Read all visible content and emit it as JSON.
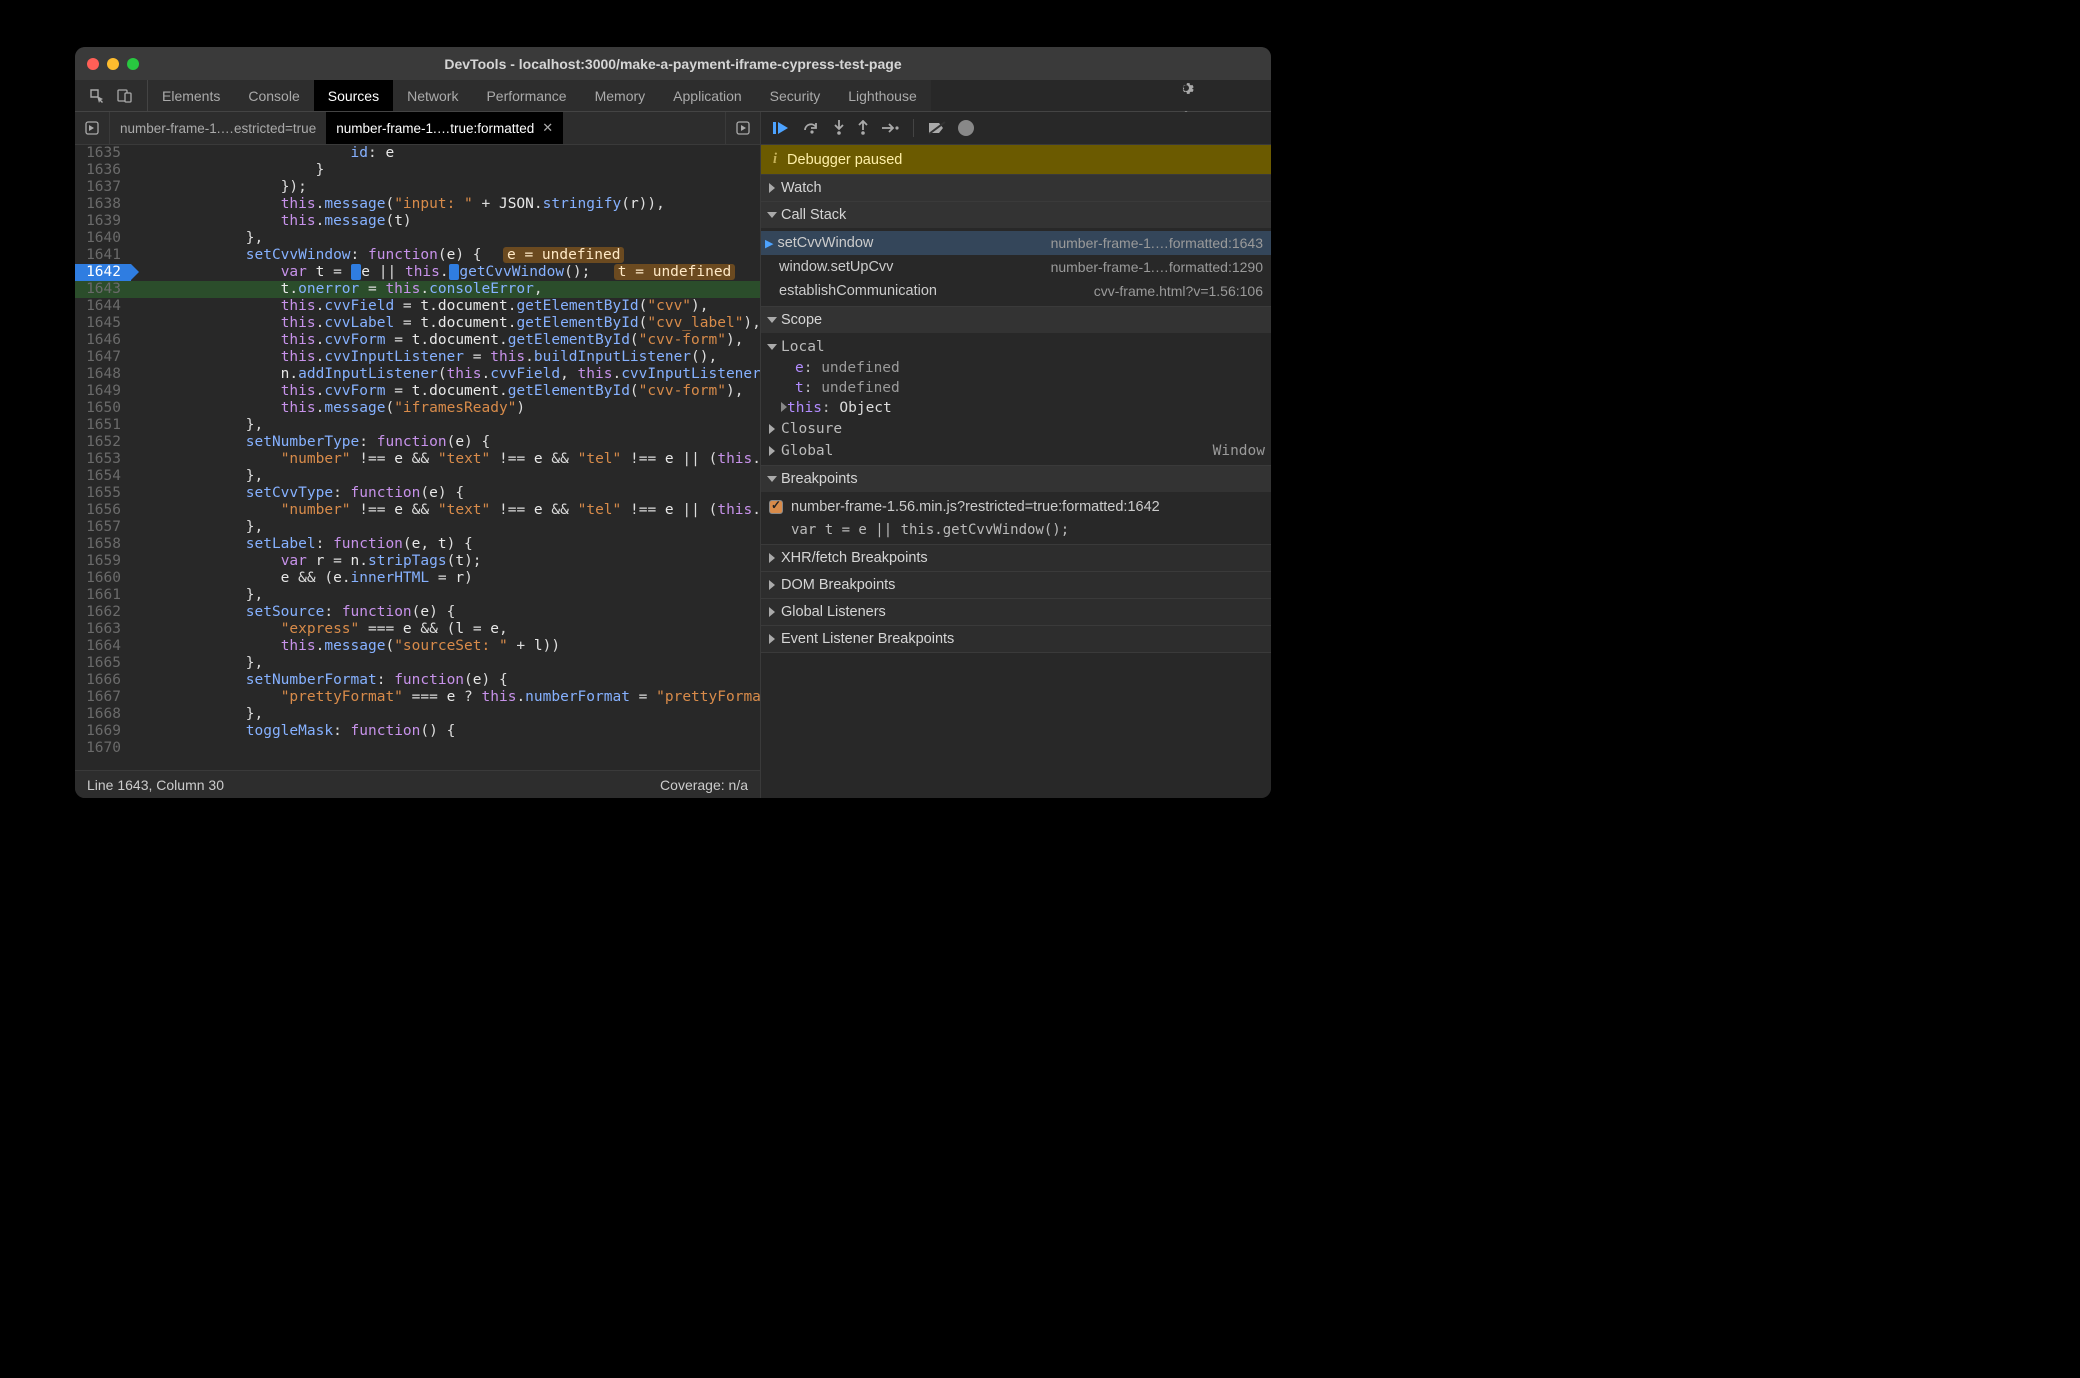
{
  "window": {
    "title": "DevTools - localhost:3000/make-a-payment-iframe-cypress-test-page"
  },
  "tabs": [
    "Elements",
    "Console",
    "Sources",
    "Network",
    "Performance",
    "Memory",
    "Application",
    "Security",
    "Lighthouse"
  ],
  "activeTab": "Sources",
  "fileTabs": {
    "first": "number-frame-1.…estricted=true",
    "second": "number-frame-1.…true:formatted"
  },
  "debugger": {
    "bannerLabel": "Debugger paused",
    "sections": {
      "watch": "Watch",
      "callstack": "Call Stack",
      "scope": "Scope",
      "breakpoints": "Breakpoints",
      "xhr": "XHR/fetch Breakpoints",
      "dom": "DOM Breakpoints",
      "global": "Global Listeners",
      "event": "Event Listener Breakpoints"
    },
    "callstack": [
      {
        "fn": "setCvvWindow",
        "loc": "number-frame-1.…formatted:1643",
        "active": true
      },
      {
        "fn": "window.setUpCvv",
        "loc": "number-frame-1.…formatted:1290"
      },
      {
        "fn": "establishCommunication",
        "loc": "cvv-frame.html?v=1.56:106"
      }
    ],
    "scope": {
      "localLabel": "Local",
      "e": {
        "name": "e",
        "value": "undefined"
      },
      "t": {
        "name": "t",
        "value": "undefined"
      },
      "thisLabel": "this",
      "thisVal": "Object",
      "closure": "Closure",
      "global": "Global",
      "globalVal": "Window"
    },
    "breakpoints": {
      "file": "number-frame-1.56.min.js?restricted=true:formatted:1642",
      "code": "var t = e || this.getCvvWindow();"
    }
  },
  "statusbar": {
    "left": "Line 1643, Column 30",
    "right": "Coverage: n/a"
  },
  "code": {
    "startLine": 1635,
    "hint_e": "e = undefined",
    "hint_t": "t = undefined",
    "lines": [
      {
        "n": 1635,
        "html": "                        <span class='prop'>id</span><span class='punct'>:</span> e"
      },
      {
        "n": 1636,
        "html": "                    <span class='punct'>}</span>"
      },
      {
        "n": 1637,
        "html": "                <span class='punct'>});</span>"
      },
      {
        "n": 1638,
        "html": "                <span class='this'>this</span><span class='punct'>.</span><span class='fn'>message</span><span class='punct'>(</span><span class='str'>\"input: \"</span> <span class='punct'>+</span> JSON<span class='punct'>.</span><span class='fn'>stringify</span><span class='punct'>(</span>r<span class='punct'>)),</span>"
      },
      {
        "n": 1639,
        "html": "                <span class='this'>this</span><span class='punct'>.</span><span class='fn'>message</span><span class='punct'>(</span>t<span class='punct'>)</span>"
      },
      {
        "n": 1640,
        "html": "            <span class='punct'>},</span>"
      },
      {
        "n": 1641,
        "html": "            <span class='prop'>setCvvWindow</span><span class='punct'>:</span> <span class='kw'>function</span><span class='punct'>(</span>e<span class='punct'>) {</span>  <span class='inlinehint' data-bind='code.hint_e'></span>",
        "classes": ""
      },
      {
        "n": 1642,
        "html": "                <span class='kw'>var</span> t <span class='punct'>=</span> <span style='background:#2f7de1;border-radius:2px;padding:0 1px'> </span>e <span class='punct'>||</span> <span class='this'>this</span><span class='punct'>.</span><span style='background:#2f7de1;border-radius:2px;padding:0 1px'> </span><span class='fn'>getCvvWindow</span><span class='punct'>();</span>  <span class='inlinehint2' data-bind='code.hint_t'></span>",
        "classes": "execgut"
      },
      {
        "n": 1643,
        "html": "                t<span class='punct'>.</span><span class='prop'>onerror</span> <span class='punct'>=</span> <span class='this'>this</span><span class='punct'>.</span><span class='prop'>consoleError</span><span class='punct'>,</span>",
        "classes": "breakline"
      },
      {
        "n": 1644,
        "html": "                <span class='this'>this</span><span class='punct'>.</span><span class='prop'>cvvField</span> <span class='punct'>=</span> t<span class='punct'>.</span>document<span class='punct'>.</span><span class='fn'>getElementById</span><span class='punct'>(</span><span class='str'>\"cvv\"</span><span class='punct'>),</span>"
      },
      {
        "n": 1645,
        "html": "                <span class='this'>this</span><span class='punct'>.</span><span class='prop'>cvvLabel</span> <span class='punct'>=</span> t<span class='punct'>.</span>document<span class='punct'>.</span><span class='fn'>getElementById</span><span class='punct'>(</span><span class='str'>\"cvv_label\"</span><span class='punct'>),</span>"
      },
      {
        "n": 1646,
        "html": "                <span class='this'>this</span><span class='punct'>.</span><span class='prop'>cvvForm</span> <span class='punct'>=</span> t<span class='punct'>.</span>document<span class='punct'>.</span><span class='fn'>getElementById</span><span class='punct'>(</span><span class='str'>\"cvv-form\"</span><span class='punct'>),</span>"
      },
      {
        "n": 1647,
        "html": "                <span class='this'>this</span><span class='punct'>.</span><span class='prop'>cvvInputListener</span> <span class='punct'>=</span> <span class='this'>this</span><span class='punct'>.</span><span class='fn'>buildInputListener</span><span class='punct'>(),</span>"
      },
      {
        "n": 1648,
        "html": "                n<span class='punct'>.</span><span class='fn'>addInputListener</span><span class='punct'>(</span><span class='this'>this</span><span class='punct'>.</span><span class='prop'>cvvField</span><span class='punct'>,</span> <span class='this'>this</span><span class='punct'>.</span><span class='prop'>cvvInputListener</span><span class='punct'>),</span>"
      },
      {
        "n": 1649,
        "html": "                <span class='this'>this</span><span class='punct'>.</span><span class='prop'>cvvForm</span> <span class='punct'>=</span> t<span class='punct'>.</span>document<span class='punct'>.</span><span class='fn'>getElementById</span><span class='punct'>(</span><span class='str'>\"cvv-form\"</span><span class='punct'>),</span>"
      },
      {
        "n": 1650,
        "html": "                <span class='this'>this</span><span class='punct'>.</span><span class='fn'>message</span><span class='punct'>(</span><span class='str'>\"iframesReady\"</span><span class='punct'>)</span>"
      },
      {
        "n": 1651,
        "html": "            <span class='punct'>},</span>"
      },
      {
        "n": 1652,
        "html": "            <span class='prop'>setNumberType</span><span class='punct'>:</span> <span class='kw'>function</span><span class='punct'>(</span>e<span class='punct'>) {</span>"
      },
      {
        "n": 1653,
        "html": "                <span class='str'>\"number\"</span> <span class='punct'>!==</span> e <span class='punct'>&amp;&amp;</span> <span class='str'>\"text\"</span> <span class='punct'>!==</span> e <span class='punct'>&amp;&amp;</span> <span class='str'>\"tel\"</span> <span class='punct'>!==</span> e <span class='punct'>||</span> <span class='punct'>(</span><span class='this'>this</span><span class='punct'>.</span><span class='prop'>numberFi</span>"
      },
      {
        "n": 1654,
        "html": "            <span class='punct'>},</span>"
      },
      {
        "n": 1655,
        "html": "            <span class='prop'>setCvvType</span><span class='punct'>:</span> <span class='kw'>function</span><span class='punct'>(</span>e<span class='punct'>) {</span>"
      },
      {
        "n": 1656,
        "html": "                <span class='str'>\"number\"</span> <span class='punct'>!==</span> e <span class='punct'>&amp;&amp;</span> <span class='str'>\"text\"</span> <span class='punct'>!==</span> e <span class='punct'>&amp;&amp;</span> <span class='str'>\"tel\"</span> <span class='punct'>!==</span> e <span class='punct'>||</span> <span class='punct'>(</span><span class='this'>this</span><span class='punct'>.</span><span class='prop'>cvvFielc</span>"
      },
      {
        "n": 1657,
        "html": "            <span class='punct'>},</span>"
      },
      {
        "n": 1658,
        "html": "            <span class='prop'>setLabel</span><span class='punct'>:</span> <span class='kw'>function</span><span class='punct'>(</span>e<span class='punct'>,</span> t<span class='punct'>) {</span>"
      },
      {
        "n": 1659,
        "html": "                <span class='kw'>var</span> r <span class='punct'>=</span> n<span class='punct'>.</span><span class='fn'>stripTags</span><span class='punct'>(</span>t<span class='punct'>);</span>"
      },
      {
        "n": 1660,
        "html": "                e <span class='punct'>&amp;&amp;</span> <span class='punct'>(</span>e<span class='punct'>.</span><span class='prop'>innerHTML</span> <span class='punct'>=</span> r<span class='punct'>)</span>"
      },
      {
        "n": 1661,
        "html": "            <span class='punct'>},</span>"
      },
      {
        "n": 1662,
        "html": "            <span class='prop'>setSource</span><span class='punct'>:</span> <span class='kw'>function</span><span class='punct'>(</span>e<span class='punct'>) {</span>"
      },
      {
        "n": 1663,
        "html": "                <span class='str'>\"express\"</span> <span class='punct'>===</span> e <span class='punct'>&amp;&amp;</span> <span class='punct'>(</span>l <span class='punct'>=</span> e<span class='punct'>,</span>"
      },
      {
        "n": 1664,
        "html": "                <span class='this'>this</span><span class='punct'>.</span><span class='fn'>message</span><span class='punct'>(</span><span class='str'>\"sourceSet: \"</span> <span class='punct'>+</span> l<span class='punct'>))</span>"
      },
      {
        "n": 1665,
        "html": "            <span class='punct'>},</span>"
      },
      {
        "n": 1666,
        "html": "            <span class='prop'>setNumberFormat</span><span class='punct'>:</span> <span class='kw'>function</span><span class='punct'>(</span>e<span class='punct'>) {</span>"
      },
      {
        "n": 1667,
        "html": "                <span class='str'>\"prettyFormat\"</span> <span class='punct'>===</span> e <span class='punct'>?</span> <span class='this'>this</span><span class='punct'>.</span><span class='prop'>numberFormat</span> <span class='punct'>=</span> <span class='str'>\"prettyFormat\"</span> <span class='punct'>:</span> <span class='str'>\"pl</span>"
      },
      {
        "n": 1668,
        "html": "            <span class='punct'>},</span>"
      },
      {
        "n": 1669,
        "html": "            <span class='prop'>toggleMask</span><span class='punct'>:</span> <span class='kw'>function</span><span class='punct'>() {</span>"
      },
      {
        "n": 1670,
        "html": ""
      }
    ]
  }
}
